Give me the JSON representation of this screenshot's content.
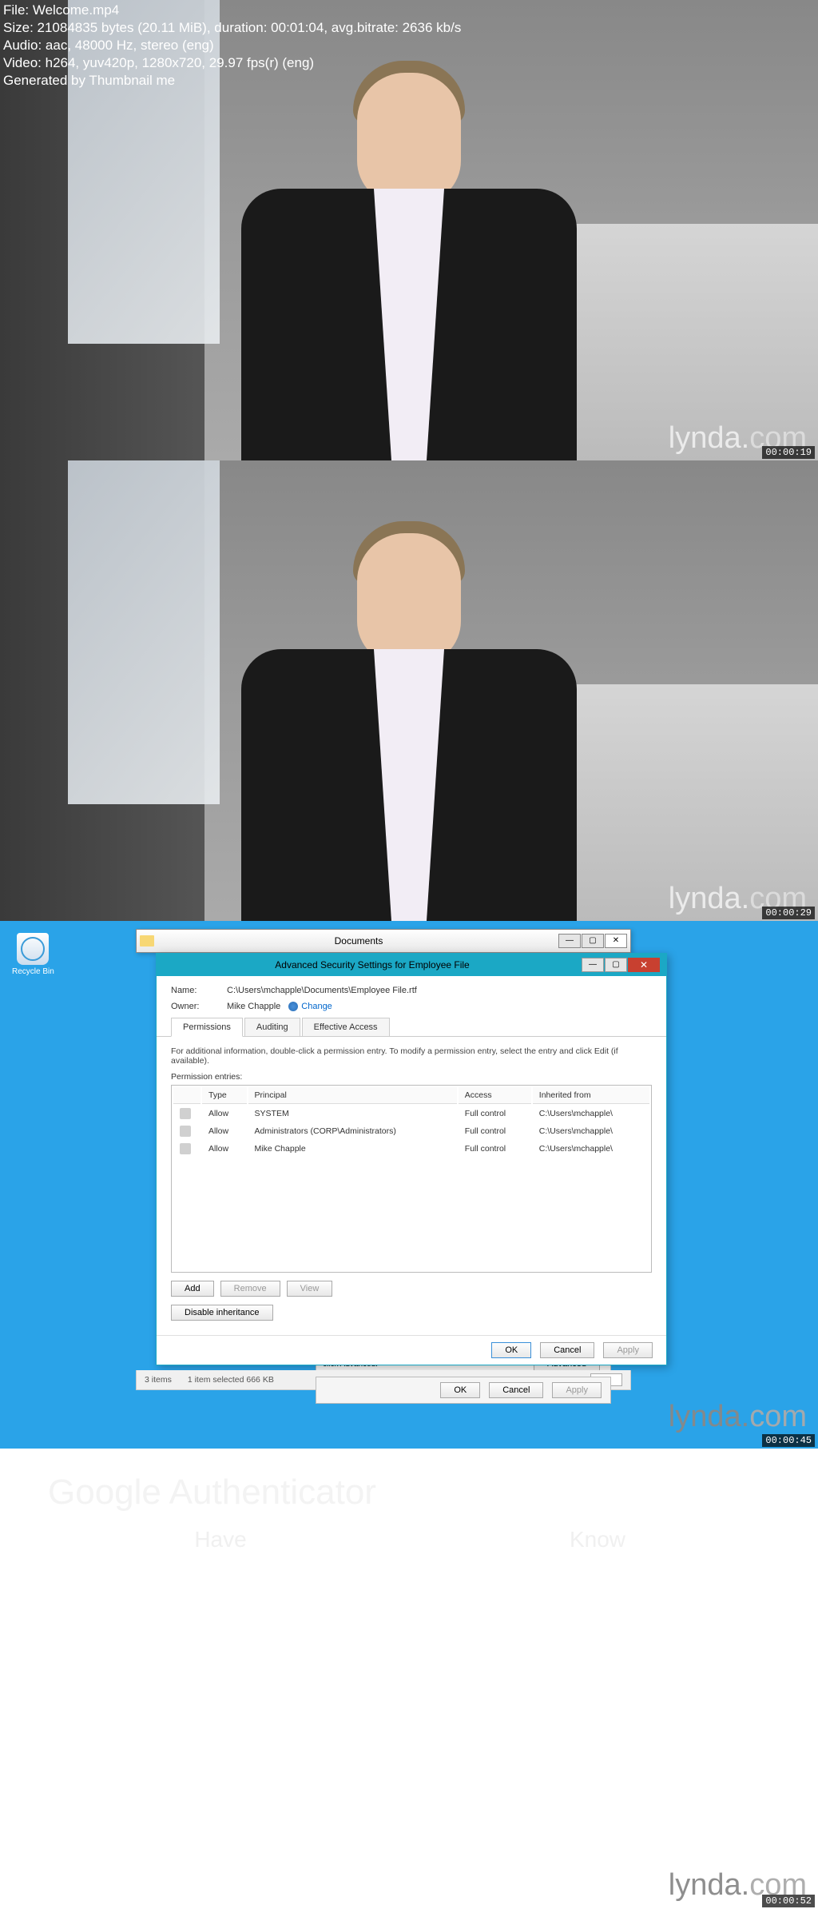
{
  "meta": {
    "file": "File: Welcome.mp4",
    "size": "Size: 21084835 bytes (20.11 MiB), duration: 00:01:04, avg.bitrate: 2636 kb/s",
    "audio": "Audio: aac, 48000 Hz, stereo (eng)",
    "video": "Video: h264, yuv420p, 1280x720, 29.97 fps(r) (eng)",
    "generator": "Generated by Thumbnail me"
  },
  "watermark": {
    "lynda": "lynda",
    "dot": ".",
    "com": "com"
  },
  "frame1": {
    "timestamp": "00:00:19"
  },
  "frame2": {
    "timestamp": "00:00:29"
  },
  "frame3": {
    "timestamp": "00:00:45",
    "recycle": "Recycle Bin",
    "explorer_title": "Documents",
    "dialog_title": "Advanced Security Settings for Employee File",
    "name_label": "Name:",
    "name_value": "C:\\Users\\mchapple\\Documents\\Employee File.rtf",
    "owner_label": "Owner:",
    "owner_value": "Mike Chapple",
    "change": "Change",
    "tabs": {
      "perm": "Permissions",
      "audit": "Auditing",
      "eff": "Effective Access"
    },
    "info": "For additional information, double-click a permission entry. To modify a permission entry, select the entry and click Edit (if available).",
    "perm_entries": "Permission entries:",
    "cols": {
      "type": "Type",
      "principal": "Principal",
      "access": "Access",
      "inherited": "Inherited from"
    },
    "rows": [
      {
        "type": "Allow",
        "principal": "SYSTEM",
        "access": "Full control",
        "inherited": "C:\\Users\\mchapple\\"
      },
      {
        "type": "Allow",
        "principal": "Administrators (CORP\\Administrators)",
        "access": "Full control",
        "inherited": "C:\\Users\\mchapple\\"
      },
      {
        "type": "Allow",
        "principal": "Mike Chapple",
        "access": "Full control",
        "inherited": "C:\\Users\\mchapple\\"
      }
    ],
    "buttons": {
      "add": "Add",
      "remove": "Remove",
      "view": "View",
      "disable": "Disable inheritance",
      "ok": "OK",
      "cancel": "Cancel",
      "apply": "Apply"
    },
    "status": {
      "items": "3 items",
      "selected": "1 item selected  666 KB"
    },
    "outer_hint": "click Advanced."
  },
  "frame4": {
    "timestamp": "00:00:52",
    "title": "Google Authenticator",
    "col1": "Have",
    "col2": "Know"
  }
}
